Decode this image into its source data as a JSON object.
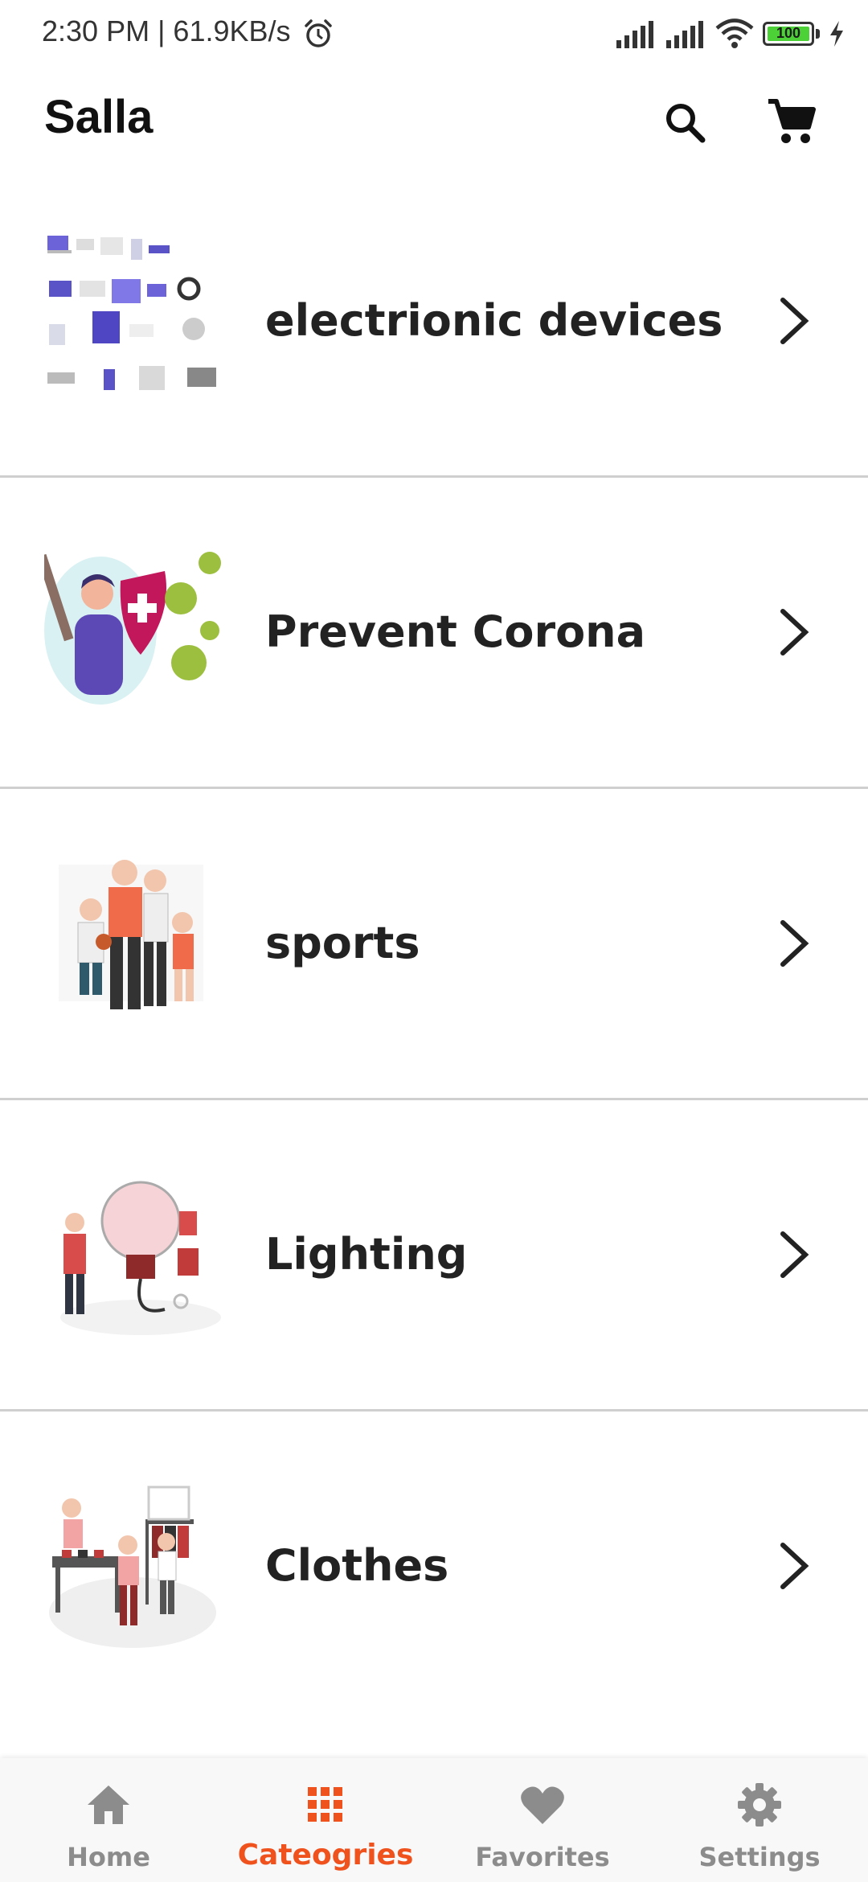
{
  "status_bar": {
    "time_speed": "2:30 PM | 61.9KB/s",
    "battery": "100"
  },
  "app_bar": {
    "title": "Salla",
    "icons": [
      "search-icon",
      "cart-icon"
    ]
  },
  "categories": [
    {
      "label": "electrionic devices"
    },
    {
      "label": "Prevent Corona"
    },
    {
      "label": "sports"
    },
    {
      "label": "Lighting"
    },
    {
      "label": "Clothes"
    }
  ],
  "bottom_nav": {
    "items": [
      {
        "label": "Home",
        "icon": "home-icon",
        "active": false
      },
      {
        "label": "Cateogries",
        "icon": "grid-icon",
        "active": true
      },
      {
        "label": "Favorites",
        "icon": "heart-icon",
        "active": false
      },
      {
        "label": "Settings",
        "icon": "gear-icon",
        "active": false
      }
    ]
  },
  "colors": {
    "accent": "#f0521e",
    "inactive": "#8c8c8c",
    "divider": "#cfcfcf"
  }
}
